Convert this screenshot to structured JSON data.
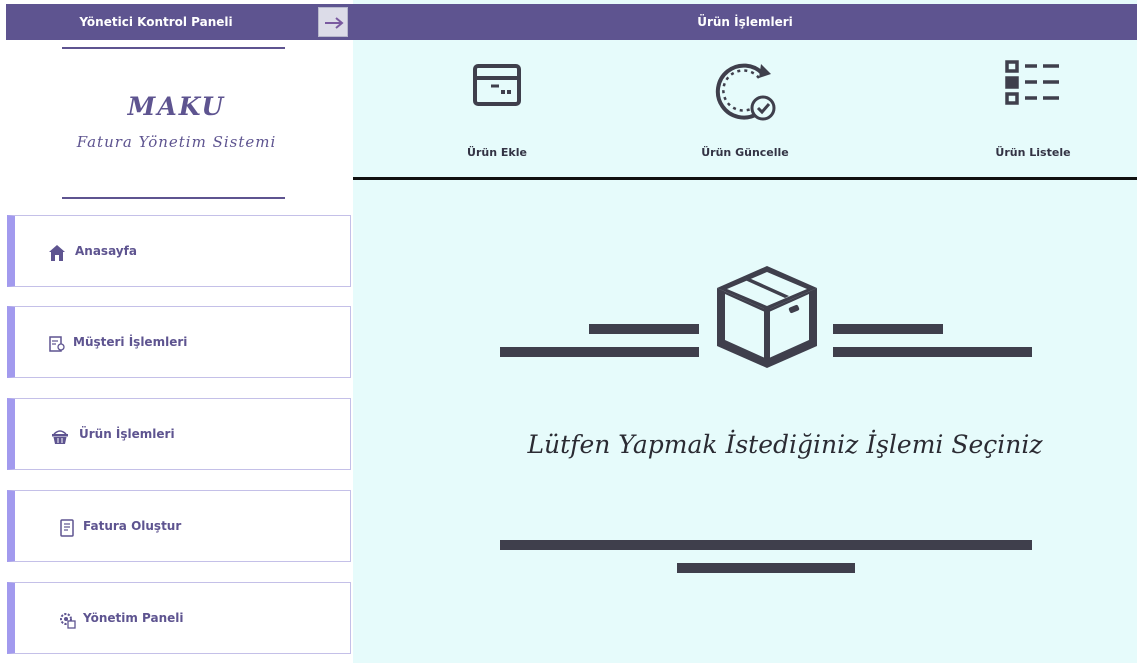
{
  "sidebar": {
    "header_title": "Yönetici Kontrol Paneli",
    "brand": {
      "title": "MAKU",
      "subtitle": "Fatura Yönetim Sistemi"
    },
    "nav": [
      {
        "label": "Anasayfa",
        "icon": "home-icon"
      },
      {
        "label": "Müşteri İşlemleri",
        "icon": "customer-icon"
      },
      {
        "label": "Ürün İşlemleri",
        "icon": "basket-icon"
      },
      {
        "label": "Fatura Oluştur",
        "icon": "invoice-icon"
      },
      {
        "label": "Yönetim Paneli",
        "icon": "settings-gear-icon"
      }
    ]
  },
  "main": {
    "header_title": "Ürün İşlemleri",
    "actions": [
      {
        "label": "Ürün Ekle",
        "icon": "add-box-icon"
      },
      {
        "label": "Ürün Güncelle",
        "icon": "refresh-check-icon"
      },
      {
        "label": "Ürün Listele",
        "icon": "list-icon"
      }
    ],
    "prompt": "Lütfen Yapmak İstediğiniz İşlemi Seçiniz"
  },
  "colors": {
    "header": "#5e5490",
    "accent": "#a29aee",
    "content_bg": "#e6fbfb",
    "dark": "#3f3f4c"
  }
}
